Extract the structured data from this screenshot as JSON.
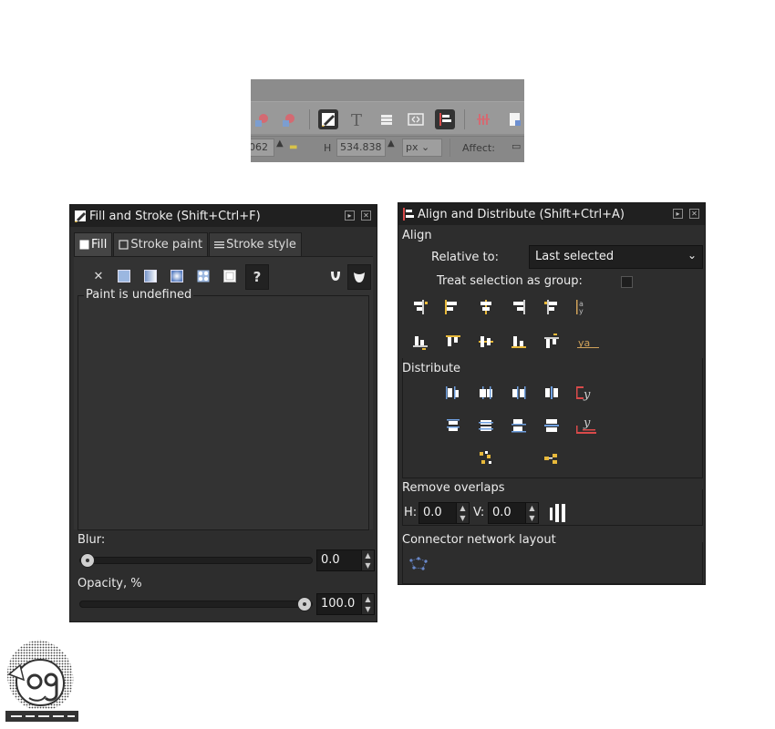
{
  "toolbar": {
    "icons": [
      "object-to-path-icon",
      "path-icon",
      "fill-stroke-icon",
      "text-icon",
      "layers-icon",
      "xml-editor-icon",
      "align-distribute-icon",
      "transform-icon",
      "document-properties-icon"
    ],
    "w_value": "062",
    "h_label": "H",
    "h_value": "534.838",
    "unit": "px",
    "affect_label": "Affect:"
  },
  "fill_stroke": {
    "title": "Fill and Stroke (Shift+Ctrl+F)",
    "tabs": [
      {
        "label": "Fill",
        "active": true
      },
      {
        "label": "Stroke paint",
        "active": false
      },
      {
        "label": "Stroke style",
        "active": false
      }
    ],
    "paint_types": [
      "no-paint-icon",
      "flat-color-icon",
      "linear-gradient-icon",
      "radial-gradient-icon",
      "pattern-icon",
      "swatch-icon",
      "unset-paint-icon"
    ],
    "frame_label": "Paint is undefined",
    "blur_label": "Blur:",
    "blur_value": "0.0",
    "blur_fraction": 0.0,
    "opacity_label": "Opacity, %",
    "opacity_value": "100.0",
    "opacity_fraction": 1.0
  },
  "align": {
    "title": "Align and Distribute (Shift+Ctrl+A)",
    "align_section": "Align",
    "relative_label": "Relative to:",
    "relative_value": "Last selected",
    "treat_group_label": "Treat selection as group:",
    "treat_group_checked": false,
    "distribute_section": "Distribute",
    "remove_overlaps_section": "Remove overlaps",
    "h_label": "H:",
    "h_value": "0.0",
    "v_label": "V:",
    "v_value": "0.0",
    "connector_section": "Connector network layout"
  },
  "colors": {
    "panel_bg": "#2d2d2d",
    "title_bg": "#202020",
    "accent_yellow": "#e8b93a",
    "accent_blue": "#7ea3d6"
  }
}
